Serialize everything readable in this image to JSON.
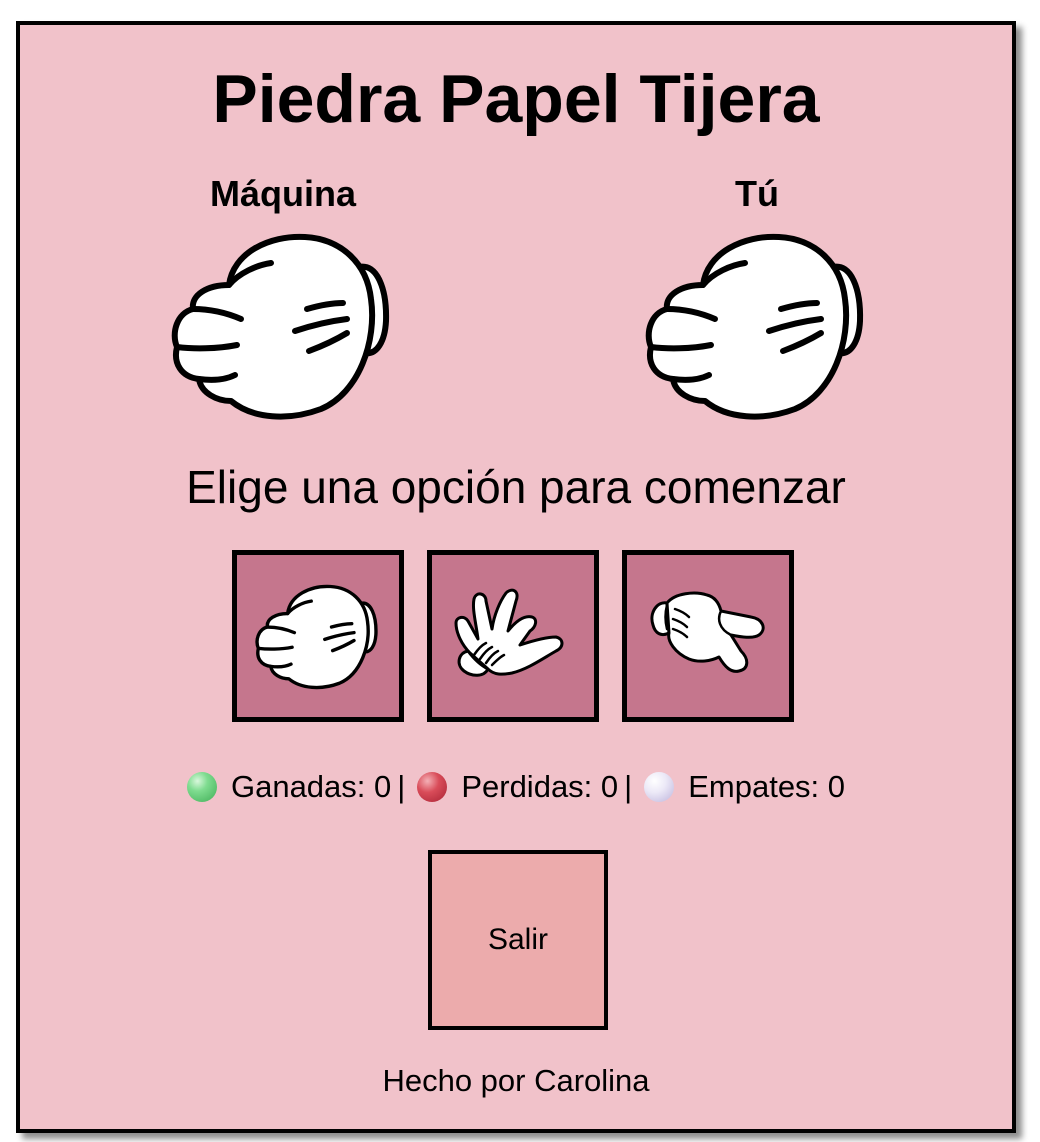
{
  "title": "Piedra Papel Tijera",
  "players": {
    "machine_label": "Máquina",
    "you_label": "Tú",
    "machine_choice_icon": "rock-fist-icon",
    "you_choice_icon": "rock-fist-icon"
  },
  "status_message": "Elige una opción para comenzar",
  "options": [
    {
      "icon": "rock-fist-icon"
    },
    {
      "icon": "paper-hand-icon"
    },
    {
      "icon": "scissors-hand-icon"
    }
  ],
  "score": {
    "wins_label": "Ganadas: 0",
    "losses_label": "Perdidas: 0",
    "ties_label": "Empates: 0",
    "separator": "|",
    "wins_color": "#5fc873",
    "losses_color": "#c93a4a",
    "ties_color": "#ddd8ef"
  },
  "exit_label": "Salir",
  "footer": "Hecho por Carolina",
  "colors": {
    "panel_background": "#f1c2ca",
    "option_button_background": "#c5768d",
    "exit_button_background": "#ecabac",
    "border": "#000000"
  }
}
